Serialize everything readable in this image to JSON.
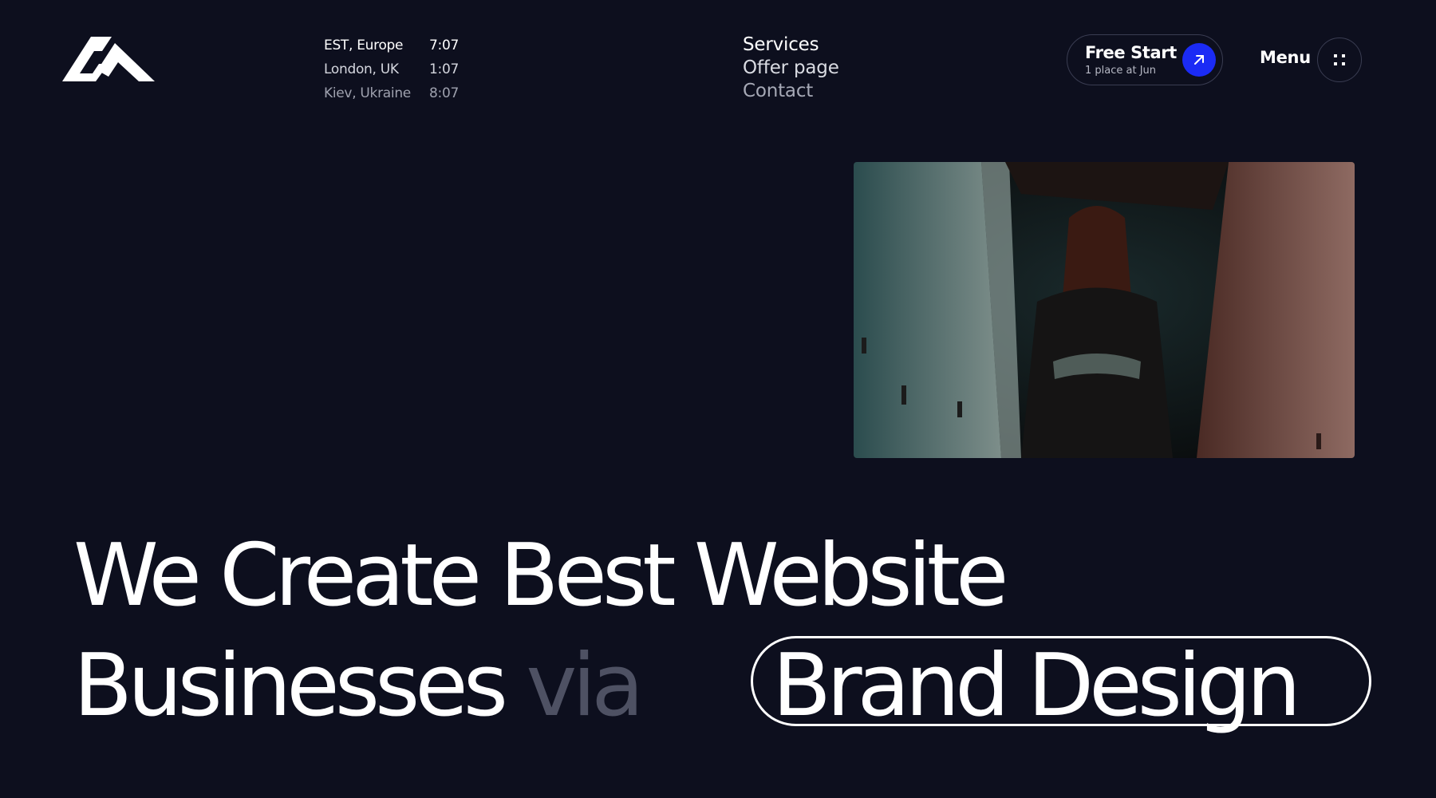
{
  "header": {
    "logo_icon": "mountain-logo-icon",
    "clocks": [
      {
        "city": "EST, Europe",
        "time": "7:07"
      },
      {
        "city": "London, UK",
        "time": "1:07"
      },
      {
        "city": "Kiev, Ukraine",
        "time": "8:07"
      }
    ],
    "nav": [
      "Services",
      "Offer page",
      "Contact"
    ],
    "free_start": {
      "title": "Free Start",
      "subtitle": "1 place at Jun",
      "icon": "arrow-up-right-icon",
      "accent": "#1b2bf5"
    },
    "menu": {
      "label": "Menu",
      "icon": "grid-dots-icon"
    }
  },
  "hero": {
    "line1": "We Create Best Website",
    "line2_a": "Businesses",
    "line2_via": "via",
    "line2_pill": "Brand Design"
  },
  "colors": {
    "background": "#0d0f1e",
    "text": "#ffffff",
    "muted": "#4e5163",
    "accent": "#1b2bf5"
  }
}
